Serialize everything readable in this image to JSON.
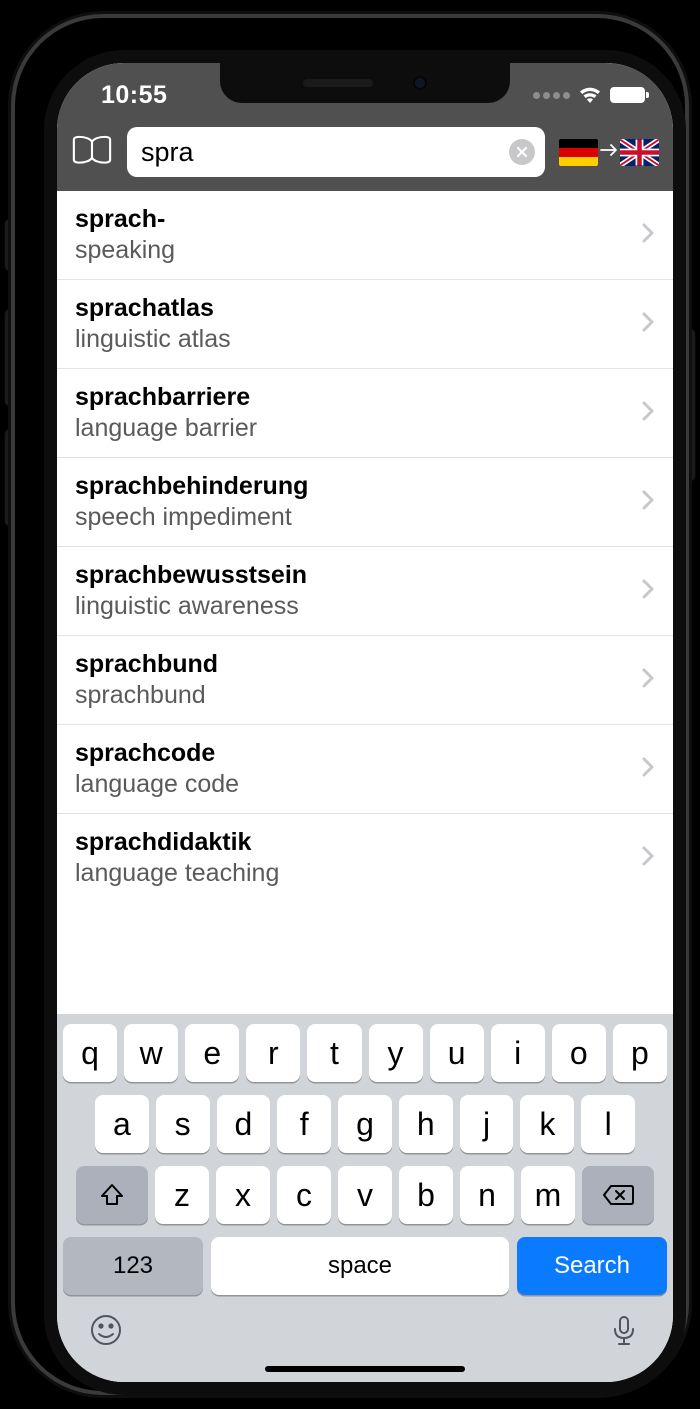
{
  "statusbar": {
    "time": "10:55"
  },
  "search": {
    "value": "spra",
    "source_lang": "de",
    "target_lang": "en"
  },
  "results": [
    {
      "term": "sprach-",
      "translation": "speaking"
    },
    {
      "term": "sprachatlas",
      "translation": "linguistic atlas"
    },
    {
      "term": "sprachbarriere",
      "translation": "language barrier"
    },
    {
      "term": "sprachbehinderung",
      "translation": "speech impediment"
    },
    {
      "term": "sprachbewusstsein",
      "translation": "linguistic awareness"
    },
    {
      "term": "sprachbund",
      "translation": "sprachbund"
    },
    {
      "term": "sprachcode",
      "translation": "language code"
    },
    {
      "term": "sprachdidaktik",
      "translation": "language teaching"
    }
  ],
  "keyboard": {
    "row1": [
      "q",
      "w",
      "e",
      "r",
      "t",
      "y",
      "u",
      "i",
      "o",
      "p"
    ],
    "row2": [
      "a",
      "s",
      "d",
      "f",
      "g",
      "h",
      "j",
      "k",
      "l"
    ],
    "row3": [
      "z",
      "x",
      "c",
      "v",
      "b",
      "n",
      "m"
    ],
    "numKey": "123",
    "spaceLabel": "space",
    "searchLabel": "Search"
  }
}
